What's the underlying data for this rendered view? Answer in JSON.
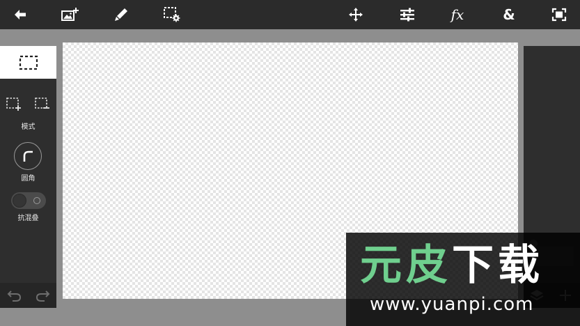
{
  "toolbar": {
    "icons": [
      "back-arrow-icon",
      "add-image-icon",
      "brush-icon",
      "selection-settings-icon",
      "move-icon",
      "adjustments-icon",
      "fx-icon",
      "blend-icon",
      "fullscreen-icon"
    ],
    "fx_label": "fx",
    "blend_label": "&"
  },
  "left_panel": {
    "mode_label": "模式",
    "corner_label": "圆角",
    "antialias_label": "抗混叠",
    "antialias_on": false
  },
  "watermark": {
    "text_part1": "元皮",
    "text_part2": "下载",
    "url": "www.yuanpi.com"
  },
  "colors": {
    "topbar": "#2b2b2b",
    "panel": "#2e2e2e",
    "workspace": "#8e8e8e",
    "watermark_green": "#6fcf8e"
  }
}
